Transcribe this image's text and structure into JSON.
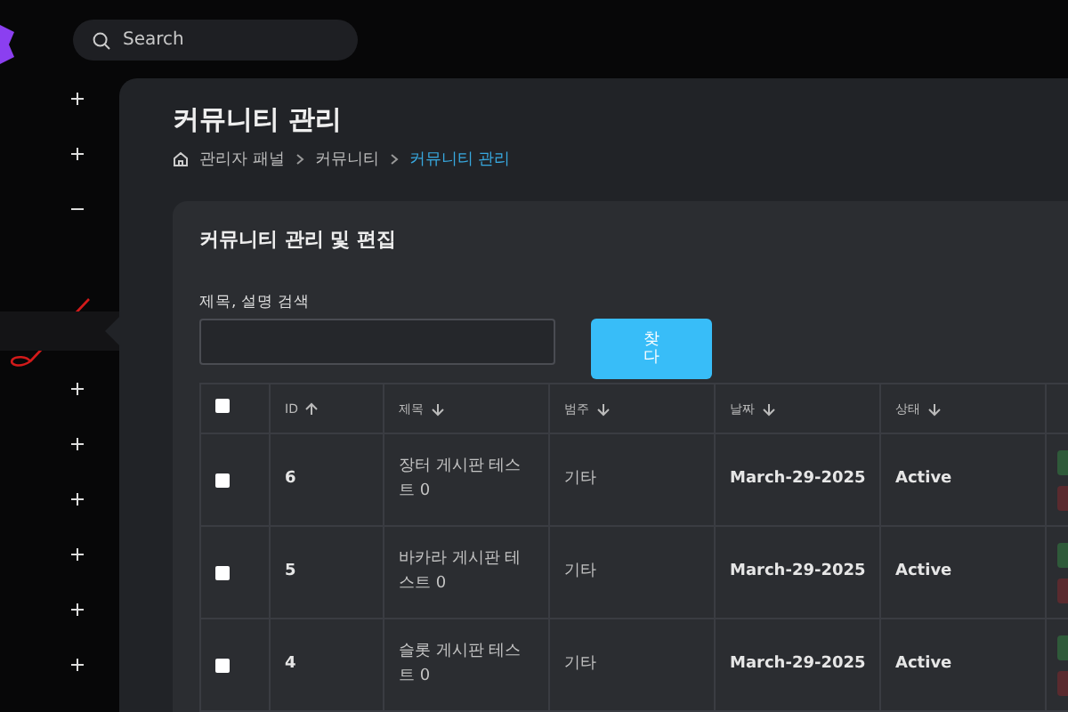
{
  "search": {
    "placeholder": "Search"
  },
  "sidebar": {
    "toggles": [
      {
        "expanded": false
      },
      {
        "expanded": false
      },
      {
        "expanded": true
      },
      {
        "expanded": false
      },
      {
        "expanded": false
      },
      {
        "expanded": false
      },
      {
        "expanded": false
      },
      {
        "expanded": false
      },
      {
        "expanded": false
      }
    ]
  },
  "page": {
    "title": "커뮤니티 관리",
    "breadcrumb": [
      {
        "label": "관리자 패널",
        "selected": false
      },
      {
        "label": "커뮤니티",
        "selected": false
      },
      {
        "label": "커뮤니티 관리",
        "selected": true
      }
    ]
  },
  "card": {
    "title": "커뮤니티 관리 및 편집",
    "search_label": "제목, 설명 검색",
    "search_button": "찾다"
  },
  "table": {
    "columns": [
      {
        "label": "ID",
        "ascending": true
      },
      {
        "label": "제목",
        "ascending": false
      },
      {
        "label": "범주",
        "ascending": false
      },
      {
        "label": "날짜",
        "ascending": false
      },
      {
        "label": "상태",
        "ascending": false
      }
    ],
    "rows": [
      {
        "checked": false,
        "cells": [
          "6",
          "장터 게시판 테스트 0",
          "기타",
          "March-29-2025",
          "Active"
        ]
      },
      {
        "checked": false,
        "cells": [
          "5",
          "바카라 게시판 테스트 0",
          "기타",
          "March-29-2025",
          "Active"
        ]
      },
      {
        "checked": false,
        "cells": [
          "4",
          "슬롯 게시판 테스트 0",
          "기타",
          "March-29-2025",
          "Active"
        ]
      }
    ],
    "all_checked": false
  }
}
